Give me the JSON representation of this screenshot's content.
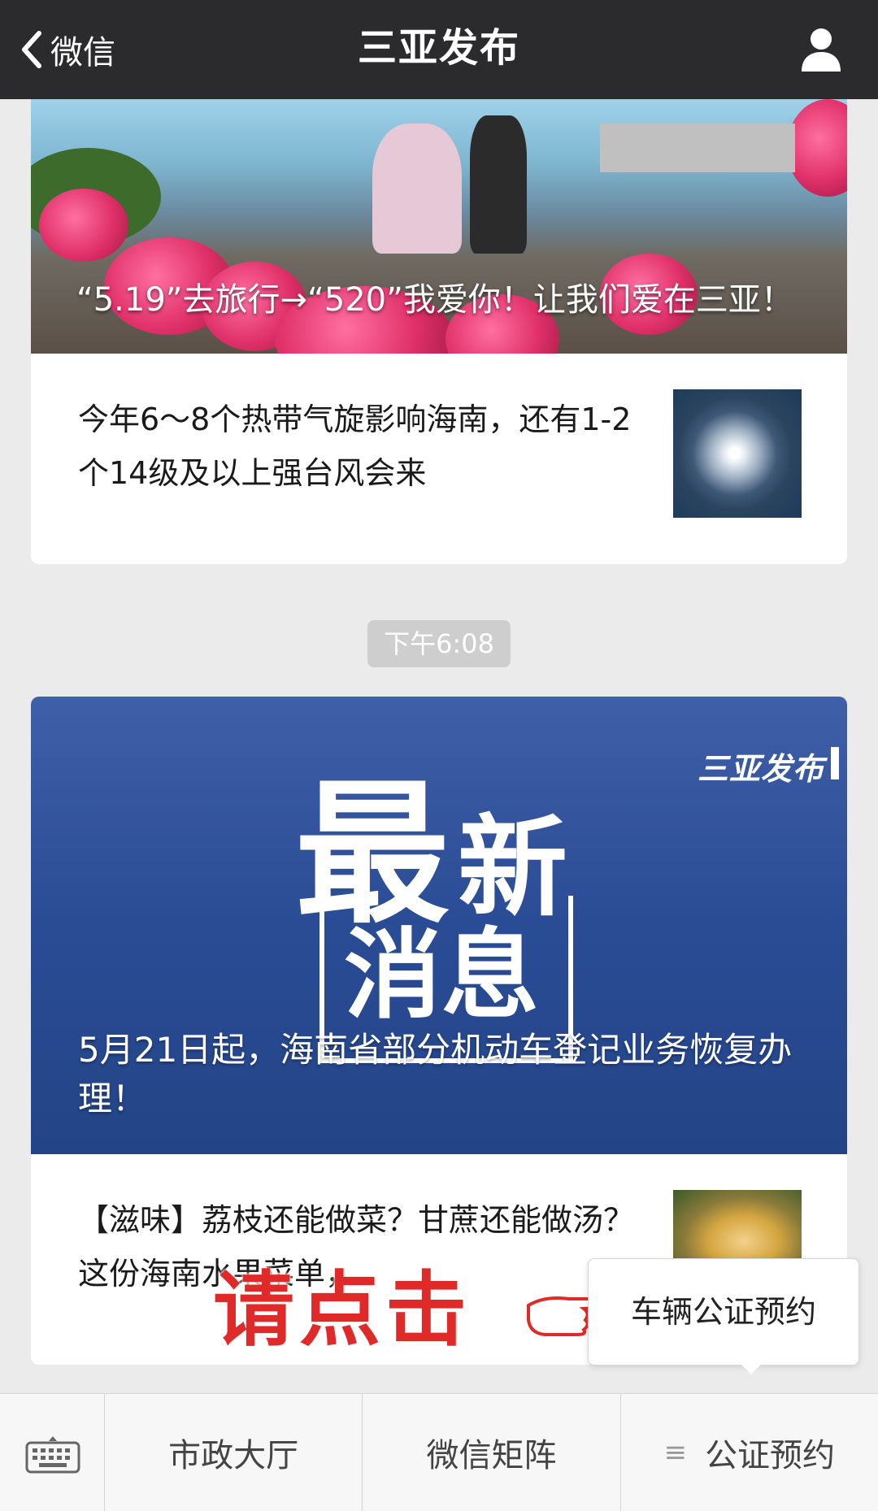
{
  "header": {
    "back_label": "微信",
    "title": "三亚发布"
  },
  "articles_group_1": {
    "cover_title": "“5.19”去旅行→“520”我爱你！让我们爱在三亚！",
    "items": [
      {
        "title": "今年6～8个热带气旋影响海南，还有1-2个14级及以上强台风会来"
      }
    ]
  },
  "timestamp": "下午6:08",
  "articles_group_2": {
    "cover_big_1": "最",
    "cover_big_2": "新",
    "cover_big_3": "消息",
    "cover_brand": "三亚发布",
    "cover_title": "5月21日起，海南省部分机动车登记业务恢复办理！",
    "items": [
      {
        "title": "【滋味】荔枝还能做菜？甘蔗还能做汤？这份海南水果菜单，"
      }
    ]
  },
  "overlay_hint": "请点击",
  "popup": {
    "label": "车辆公证预约"
  },
  "menu": {
    "items": [
      "市政大厅",
      "微信矩阵",
      "公证预约"
    ]
  },
  "icons": [
    "back-chevron-icon",
    "profile-icon",
    "keyboard-icon",
    "menu-list-icon",
    "pointing-hand-icon"
  ]
}
